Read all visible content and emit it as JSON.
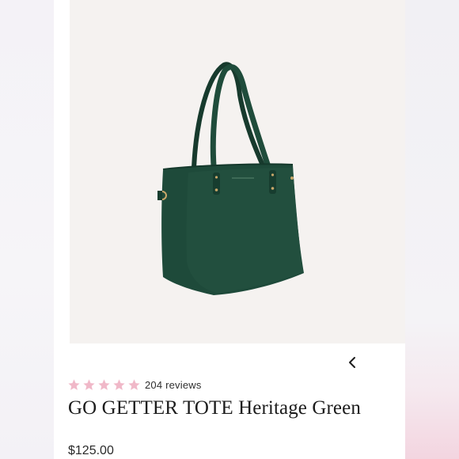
{
  "product": {
    "name": "GO GETTER TOTE Heritage Green",
    "price": "$125.00",
    "rating_stars": 5,
    "reviews_label": "204 reviews",
    "image_alt_icon": "green-tote-bag-image",
    "bag_color": "#1e4a3a"
  },
  "gallery": {
    "prev_icon": "chevron-left-icon"
  },
  "colors": {
    "star": "#f0b8c8",
    "image_bg": "#f5f2f0",
    "text_dark": "#1c1c1c"
  }
}
